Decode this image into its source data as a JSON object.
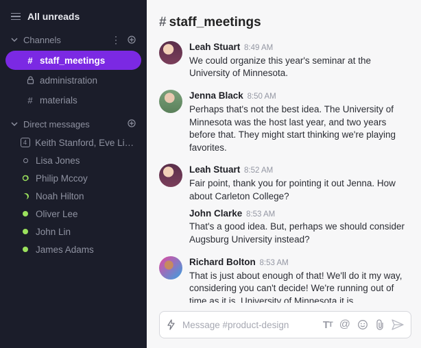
{
  "sidebar": {
    "top_label": "All unreads",
    "channels_label": "Channels",
    "dms_label": "Direct messages",
    "channels": [
      {
        "name": "staff_meetings",
        "prefix": "#",
        "active": true
      },
      {
        "name": "administration",
        "prefix": "lock",
        "active": false
      },
      {
        "name": "materials",
        "prefix": "#",
        "active": false
      }
    ],
    "dms": [
      {
        "name": "Keith Stanford, Eve Libe...",
        "presence": "badge4",
        "badge": "4"
      },
      {
        "name": "Lisa Jones",
        "presence": "offline"
      },
      {
        "name": "Philip Mccoy",
        "presence": "away"
      },
      {
        "name": "Noah Hilton",
        "presence": "crescent"
      },
      {
        "name": "Oliver Lee",
        "presence": "online"
      },
      {
        "name": "John Lin",
        "presence": "online"
      },
      {
        "name": "James Adams",
        "presence": "online"
      }
    ]
  },
  "main": {
    "channel_name": "staff_meetings",
    "messages": [
      {
        "author": "Leah Stuart",
        "time": "8:49 AM",
        "avatar": "av1",
        "text": "We could organize this year's seminar at the University of Minnesota."
      },
      {
        "author": "Jenna Black",
        "time": "8:50 AM",
        "avatar": "av2",
        "text": "Perhaps that's not the best idea. The University of Minnesota was the host last year, and two years before that. They might start thinking we're playing favorites."
      },
      {
        "author": "Leah Stuart",
        "time": "8:52 AM",
        "avatar": "av1",
        "text": "Fair point, thank you for pointing it out Jenna. How about Carleton College?"
      },
      {
        "author": "John Clarke",
        "time": "8:53 AM",
        "avatar": "",
        "text": "That's a good idea. But, perhaps we should consider Augsburg University instead?"
      },
      {
        "author": "Richard Bolton",
        "time": "8:53 AM",
        "avatar": "av3",
        "text": "That is just about enough of that! We'll do it my way, considering you can't decide! We're running out of time as it is. University of Minnesota it is."
      }
    ],
    "composer_placeholder": "Message #product-design"
  }
}
